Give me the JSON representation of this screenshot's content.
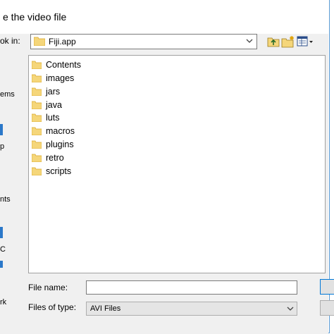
{
  "dialog": {
    "title": "e the video file"
  },
  "lookin": {
    "label": "ok in:",
    "value": "Fiji.app"
  },
  "places": {
    "items": [
      {
        "label": "ems"
      },
      {
        "label": "p"
      },
      {
        "label": "nts"
      },
      {
        "label": "C"
      },
      {
        "label": "rk"
      }
    ]
  },
  "files": [
    {
      "name": "Contents",
      "type": "folder"
    },
    {
      "name": "images",
      "type": "folder"
    },
    {
      "name": "jars",
      "type": "folder"
    },
    {
      "name": "java",
      "type": "folder"
    },
    {
      "name": "luts",
      "type": "folder"
    },
    {
      "name": "macros",
      "type": "folder"
    },
    {
      "name": "plugins",
      "type": "folder"
    },
    {
      "name": "retro",
      "type": "folder"
    },
    {
      "name": "scripts",
      "type": "folder"
    }
  ],
  "filename": {
    "label": "File name:",
    "value": ""
  },
  "filetype": {
    "label": "Files of type:",
    "value": "AVI Files"
  },
  "colors": {
    "folder": "#f5d67a",
    "folder_dark": "#d9a72c",
    "accent": "#0078d7"
  },
  "icons": [
    "folder-icon",
    "up-folder-icon",
    "new-folder-icon",
    "view-menu-icon",
    "chevron-down-icon"
  ]
}
